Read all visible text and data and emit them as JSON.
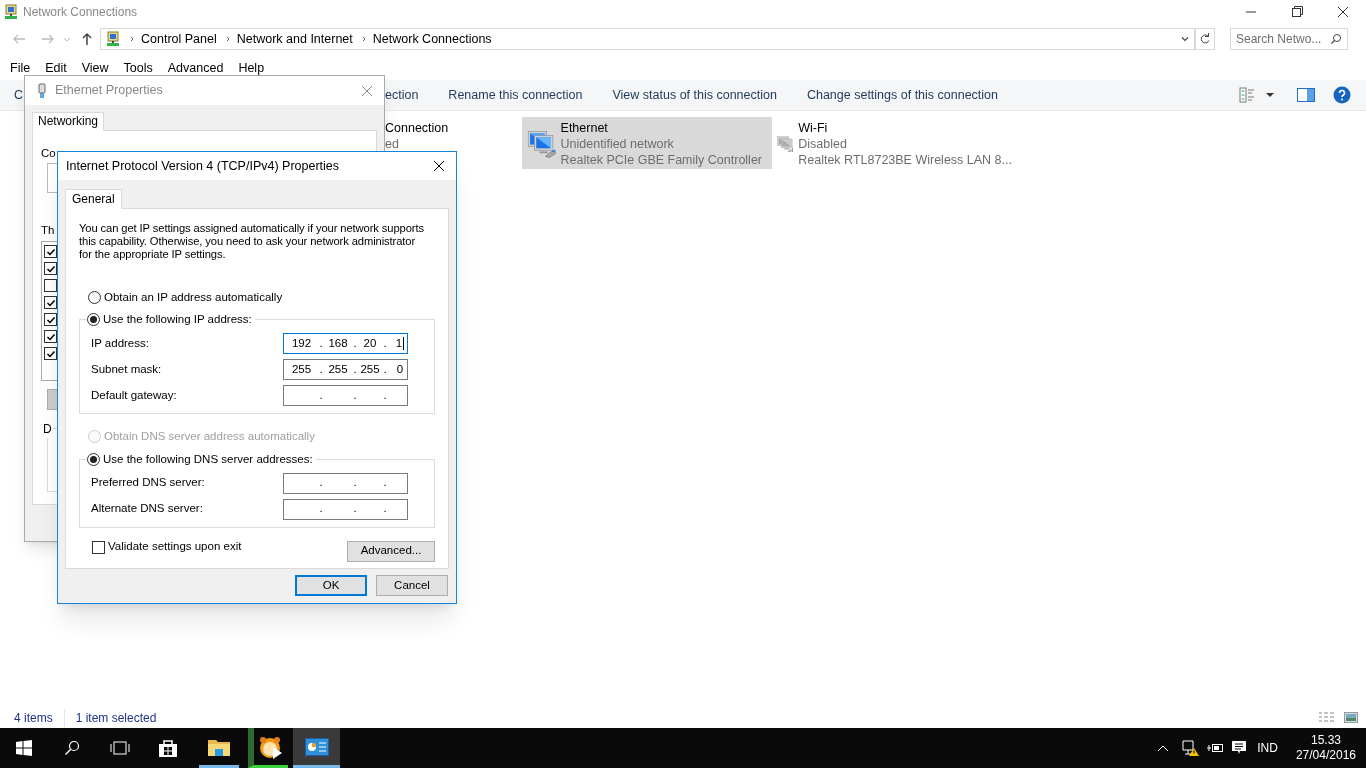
{
  "window": {
    "title": "Network Connections"
  },
  "address_bar": {
    "breadcrumbs": [
      "Control Panel",
      "Network and Internet",
      "Network Connections"
    ]
  },
  "search": {
    "placeholder": "Search Netwo..."
  },
  "menu": [
    "File",
    "Edit",
    "View",
    "Tools",
    "Advanced",
    "Help"
  ],
  "command_bar": [
    "C",
    "ection",
    "Rename this connection",
    "View status of this connection",
    "Change settings of this connection"
  ],
  "connections": [
    {
      "kind": "partial",
      "name": "Connection",
      "status": "ed",
      "selected": false
    },
    {
      "kind": "wired",
      "name": "Ethernet",
      "status": "Unidentified network",
      "device": "Realtek PCIe GBE Family Controller",
      "selected": true
    },
    {
      "kind": "wireless",
      "name": "Wi-Fi",
      "status": "Disabled",
      "device": "Realtek RTL8723BE Wireless LAN 8...",
      "selected": false
    }
  ],
  "status_bar": [
    "4 items",
    "1 item selected"
  ],
  "ethernet_properties": {
    "title": "Ethernet Properties",
    "tab": "Networking",
    "connect_label": "Co",
    "items_label": "Th",
    "group_label": "D",
    "items": [
      {
        "checked": true
      },
      {
        "checked": true
      },
      {
        "checked": false
      },
      {
        "checked": true
      },
      {
        "checked": true
      },
      {
        "checked": true
      },
      {
        "checked": true
      }
    ]
  },
  "ipv4_dialog": {
    "title": "Internet Protocol Version 4 (TCP/IPv4) Properties",
    "tab": "General",
    "description": "You can get IP settings assigned automatically if your network supports this capability. Otherwise, you need to ask your network administrator for the appropriate IP settings.",
    "separator": ".",
    "ip_options": [
      {
        "label": "Obtain an IP address automatically",
        "selected": false,
        "disabled": false
      },
      {
        "label": "Use the following IP address:",
        "selected": true,
        "disabled": false
      }
    ],
    "ip_fields": [
      {
        "label": "IP address:",
        "octets": [
          "192",
          "168",
          "20",
          "1"
        ],
        "focused": true
      },
      {
        "label": "Subnet mask:",
        "octets": [
          "255",
          "255",
          "255",
          "0"
        ],
        "focused": false
      },
      {
        "label": "Default gateway:",
        "focused": false
      }
    ],
    "dns_options": [
      {
        "label": "Obtain DNS server address automatically",
        "selected": false,
        "disabled": true
      },
      {
        "label": "Use the following DNS server addresses:",
        "selected": true,
        "disabled": false
      }
    ],
    "dns_fields": [
      {
        "label": "Preferred DNS server:",
        "focused": false
      },
      {
        "label": "Alternate DNS server:",
        "focused": false
      }
    ],
    "validate": {
      "label": "Validate settings upon exit",
      "checked": false
    },
    "advanced_button": "Advanced...",
    "buttons": [
      {
        "label": "OK",
        "default": true
      },
      {
        "label": "Cancel",
        "default": false
      }
    ]
  },
  "taskbar": {
    "apps": [
      {
        "kind": "explorer",
        "running": true,
        "active": false
      },
      {
        "kind": "media",
        "running": true,
        "active": false
      },
      {
        "kind": "control",
        "running": true,
        "active": true
      }
    ],
    "language": "IND",
    "time": "15.33",
    "date": "27/04/2016"
  }
}
